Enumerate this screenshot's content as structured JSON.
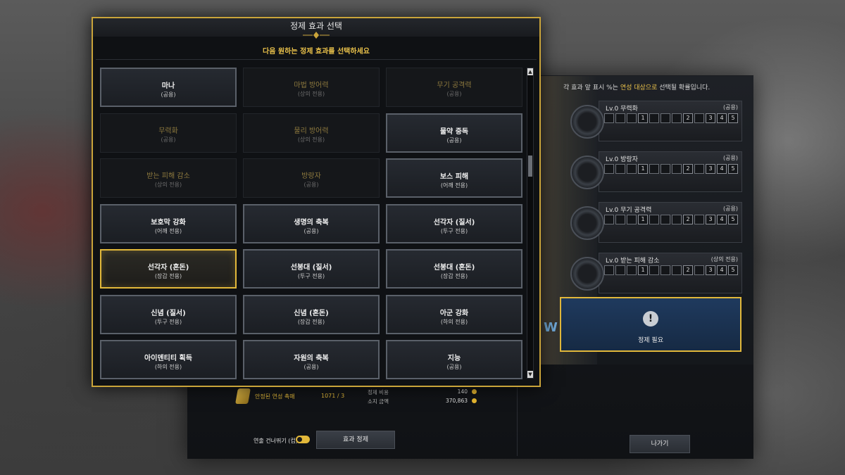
{
  "modal": {
    "title": "정제 효과 선택",
    "subtitle": "다음 원하는 정제 효과를 선택하세요",
    "effects": [
      {
        "name": "마나",
        "sub": "(공용)",
        "state": "active"
      },
      {
        "name": "마법 방어력",
        "sub": "(상의 전용)",
        "state": "dim"
      },
      {
        "name": "무기 공격력",
        "sub": "(공용)",
        "state": "dim"
      },
      {
        "name": "무력화",
        "sub": "(공용)",
        "state": "dim"
      },
      {
        "name": "물리 방어력",
        "sub": "(상의 전용)",
        "state": "dim"
      },
      {
        "name": "물약 중독",
        "sub": "(공용)",
        "state": "active"
      },
      {
        "name": "받는 피해 감소",
        "sub": "(상의 전용)",
        "state": "dim"
      },
      {
        "name": "방랑자",
        "sub": "(공용)",
        "state": "dim"
      },
      {
        "name": "보스 피해",
        "sub": "(어깨 전용)",
        "state": "active"
      },
      {
        "name": "보호막 강화",
        "sub": "(어깨 전용)",
        "state": "active"
      },
      {
        "name": "생명의 축복",
        "sub": "(공용)",
        "state": "active"
      },
      {
        "name": "선각자 (질서)",
        "sub": "(투구 전용)",
        "state": "active"
      },
      {
        "name": "선각자 (혼돈)",
        "sub": "(장갑 전용)",
        "state": "selected"
      },
      {
        "name": "선봉대 (질서)",
        "sub": "(투구 전용)",
        "state": "active"
      },
      {
        "name": "선봉대 (혼돈)",
        "sub": "(장갑 전용)",
        "state": "active"
      },
      {
        "name": "신념 (질서)",
        "sub": "(투구 전용)",
        "state": "active"
      },
      {
        "name": "신념 (혼돈)",
        "sub": "(장갑 전용)",
        "state": "active"
      },
      {
        "name": "아군 강화",
        "sub": "(하의 전용)",
        "state": "active"
      },
      {
        "name": "아이덴티티 획득",
        "sub": "(하의 전용)",
        "state": "active"
      },
      {
        "name": "자원의 축복",
        "sub": "(공용)",
        "state": "active"
      },
      {
        "name": "지능",
        "sub": "(공용)",
        "state": "active"
      }
    ]
  },
  "right": {
    "note_pre": "각 효과 앞 표시 %는 ",
    "note_hl": "연성 대상으로",
    "note_post": " 선택될 확률입니다.",
    "slots": [
      {
        "name": "Lv.0 무력화",
        "tag": "(공용)"
      },
      {
        "name": "Lv.0 방랑자",
        "tag": "(공용)"
      },
      {
        "name": "Lv.0 무기 공격력",
        "tag": "(공용)"
      },
      {
        "name": "Lv.0 받는 피해 감소",
        "tag": "(상의 전용)"
      }
    ],
    "scale_labels": [
      "1",
      "2",
      "3",
      "4",
      "5"
    ],
    "need_label": "정제 필요"
  },
  "bottom": {
    "material_name": "안정된 연성 촉매",
    "material_count": "1071 / 3",
    "cost_label": "정제 비용",
    "cost_value": "140",
    "gold_label": "소지 금액",
    "gold_value": "370,863",
    "skip_label": "연출 건너뛰기 (컵)",
    "refine_button": "효과 정제",
    "exit_button": "나가기"
  }
}
